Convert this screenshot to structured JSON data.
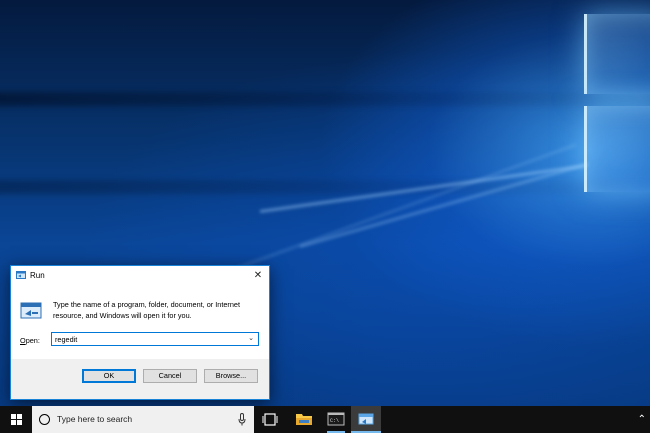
{
  "desktop": {
    "wallpaper": "windows-10-hero"
  },
  "run_dialog": {
    "title": "Run",
    "close_icon": "close-icon",
    "description": "Type the name of a program, folder, document, or Internet resource, and Windows will open it for you.",
    "open_label_accel": "O",
    "open_label_rest": "pen:",
    "open_value": "regedit",
    "buttons": {
      "ok": "OK",
      "cancel": "Cancel",
      "browse": "Browse..."
    }
  },
  "taskbar": {
    "search_placeholder": "Type here to search",
    "items": [
      "start-icon",
      "cortana-circle-icon",
      "microphone-icon",
      "task-view-icon",
      "file-explorer-icon",
      "command-prompt-icon",
      "run-icon",
      "tray-chevron-icon"
    ]
  },
  "colors": {
    "accent": "#0078d7",
    "taskbar": "#101010",
    "dialog_footer": "#f0f0f0",
    "active_indicator": "#76b9ed"
  }
}
